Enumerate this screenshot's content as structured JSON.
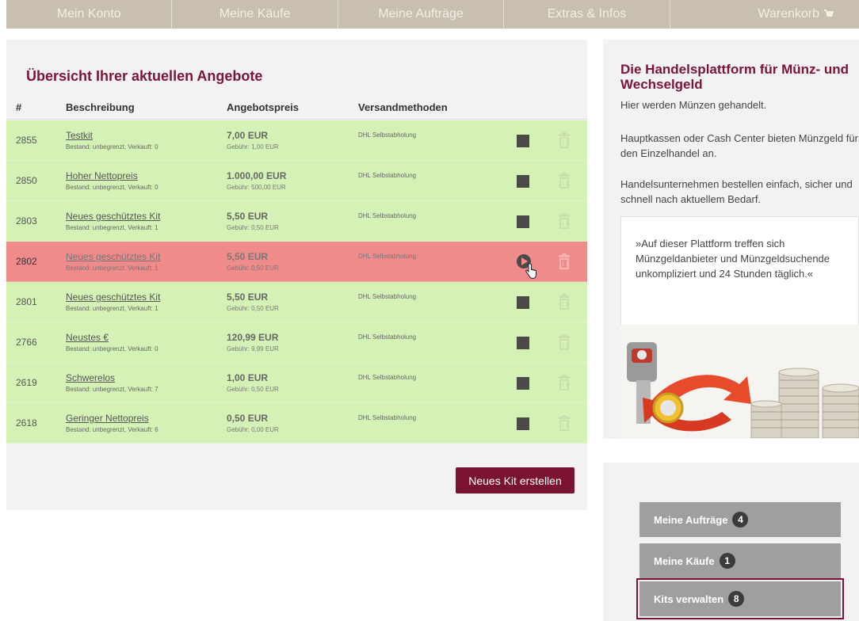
{
  "nav": {
    "items": [
      "Mein Konto",
      "Meine Käufe",
      "Meine Aufträge",
      "Extras & Infos",
      "Warenkorb"
    ]
  },
  "main": {
    "title": "Übersicht Ihrer aktuellen Angebote",
    "columns": [
      "#",
      "Beschreibung",
      "Angebotspreis",
      "Versandmethoden"
    ],
    "rows": [
      {
        "id": "2855",
        "name": "Testkit",
        "stock": "Bestand: unbegrenzt, Verkauft: 0",
        "price": "7,00 EUR",
        "fee": "Gebühr: 1,00 EUR",
        "shipping": "DHL Selbstabholung",
        "state": "active-offer"
      },
      {
        "id": "2850",
        "name": "Hoher Nettopreis",
        "stock": "Bestand: unbegrenzt, Verkauft: 0",
        "price": "1.000,00 EUR",
        "fee": "Gebühr: 500,00 EUR",
        "shipping": "DHL Selbstabholung",
        "state": "active-offer"
      },
      {
        "id": "2803",
        "name": "Neues geschütztes Kit",
        "stock": "Bestand: unbegrenzt, Verkauft: 1",
        "price": "5,50 EUR",
        "fee": "Gebühr: 0,50 EUR",
        "shipping": "DHL Selbstabholung",
        "state": "active-offer"
      },
      {
        "id": "2802",
        "name": "Neues geschütztes Kit",
        "stock": "Bestand: unbegrenzt, Verkauft: 1",
        "price": "5,50 EUR",
        "fee": "Gebühr: 0,50 EUR",
        "shipping": "DHL Selbstabholung",
        "state": "paused"
      },
      {
        "id": "2801",
        "name": "Neues geschütztes Kit",
        "stock": "Bestand: unbegrenzt, Verkauft: 1",
        "price": "5,50 EUR",
        "fee": "Gebühr: 0,50 EUR",
        "shipping": "DHL Selbstabholung",
        "state": "active-offer"
      },
      {
        "id": "2766",
        "name": "Neustes €",
        "stock": "Bestand: unbegrenzt, Verkauft: 0",
        "price": "120,99 EUR",
        "fee": "Gebühr: 9,99 EUR",
        "shipping": "DHL Selbstabholung",
        "state": "active-offer"
      },
      {
        "id": "2619",
        "name": "Schwerelos",
        "stock": "Bestand: unbegrenzt, Verkauft: 7",
        "price": "1,00 EUR",
        "fee": "Gebühr: 0,50 EUR",
        "shipping": "DHL Selbstabholung",
        "state": "active-offer"
      },
      {
        "id": "2618",
        "name": "Geringer Nettopreis",
        "stock": "Bestand: unbegrenzt, Verkauft: 6",
        "price": "0,50 EUR",
        "fee": "Gebühr: 0,00 EUR",
        "shipping": "DHL Selbstabholung",
        "state": "active-offer"
      }
    ],
    "new_kit_label": "Neues Kit erstellen"
  },
  "sidebar": {
    "title": "Die Handelsplattform für Münz- und Wechselgeld",
    "p1": "Hier werden Münzen gehandelt.",
    "p2": "Hauptkassen oder Cash Center bieten Münzgeld für den Einzelhandel an.",
    "p3": "Handelsunternehmen bestellen einfach, sicher und schnell nach aktuellem Bedarf.",
    "quote": "»Auf dieser Plattform treffen sich Münzgeldanbieter und Münzgeldsuchende unkompliziert und 24 Stunden täglich.«",
    "links": [
      {
        "label": "Meine Aufträge",
        "count": "4"
      },
      {
        "label": "Meine Käufe",
        "count": "1"
      },
      {
        "label": "Kits verwalten",
        "count": "8"
      }
    ]
  },
  "colors": {
    "brand": "#7a1232",
    "row_active": "#d5f2b6",
    "row_paused": "#f08b8b",
    "nav_bg": "#c8bfae"
  },
  "icons": {
    "cart": "cart-icon",
    "stop": "stop-icon",
    "play": "play-icon",
    "trash": "trash-icon",
    "cursor": "hand-cursor-icon"
  }
}
